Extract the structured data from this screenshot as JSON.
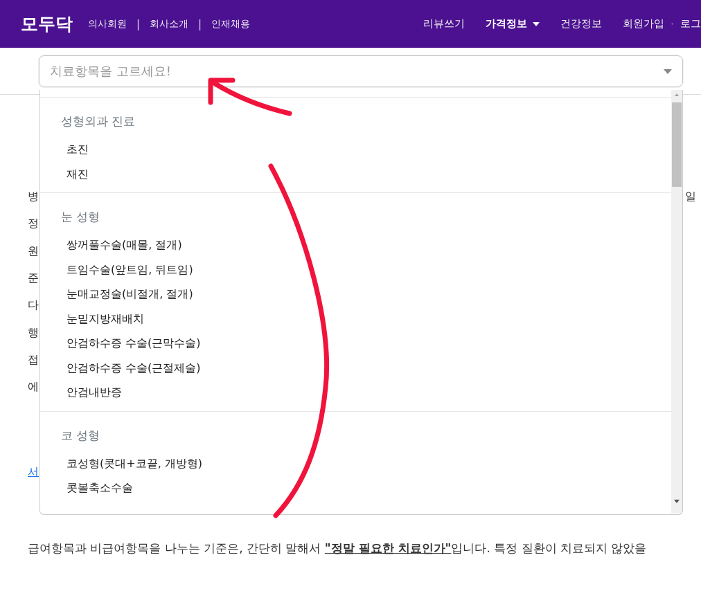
{
  "nav": {
    "logo": "모두닥",
    "left_items": [
      {
        "kind": "link",
        "label": "의사회원"
      },
      {
        "kind": "separator",
        "label": "|"
      },
      {
        "kind": "link",
        "label": "회사소개"
      },
      {
        "kind": "separator",
        "label": "|"
      },
      {
        "kind": "link",
        "label": "인재채용"
      }
    ],
    "right_items": [
      {
        "kind": "link",
        "label": "리뷰쓰기",
        "selected": false,
        "dropdown": false
      },
      {
        "kind": "link",
        "label": "가격정보",
        "selected": true,
        "dropdown": true
      },
      {
        "kind": "link",
        "label": "건강정보",
        "selected": false,
        "dropdown": false
      },
      {
        "kind": "link",
        "label": "회원가입",
        "selected": false,
        "dropdown": false
      },
      {
        "kind": "separator",
        "label": "·"
      },
      {
        "kind": "link",
        "label": "로그",
        "selected": false,
        "dropdown": false
      }
    ]
  },
  "select": {
    "placeholder": "치료항목을 고르세요!",
    "expanded": true,
    "groups": [
      {
        "label": "성형외과 진료",
        "options": [
          "초진",
          "재진"
        ]
      },
      {
        "label": "눈 성형",
        "options": [
          "쌍꺼풀수술(매몰, 절개)",
          "트임수술(앞트임, 뒤트임)",
          "눈매교정술(비절개, 절개)",
          "눈밑지방재배치",
          "안검하수증 수술(근막수술)",
          "안검하수증 수술(근절제술)",
          "안검내반증"
        ]
      },
      {
        "label": "코 성형",
        "options": [
          "코성형(콧대+코끝, 개방형)",
          "콧볼축소수술"
        ]
      }
    ]
  },
  "article": {
    "lines": [
      {
        "start": "병",
        "end": "일"
      },
      {
        "start": "정"
      },
      {
        "start": "원"
      },
      {
        "start": "준"
      },
      {
        "start": "다"
      },
      {
        "start": "행"
      },
      {
        "start": "접"
      },
      {
        "start": "에"
      }
    ],
    "link": "서",
    "sentence": "급여항목과 비급여항목을 나누는 기준은, 간단히 말해서 **\"정말 필요한 치료인가\"**입니다. 특정 질환이 치료되지 않았을"
  }
}
